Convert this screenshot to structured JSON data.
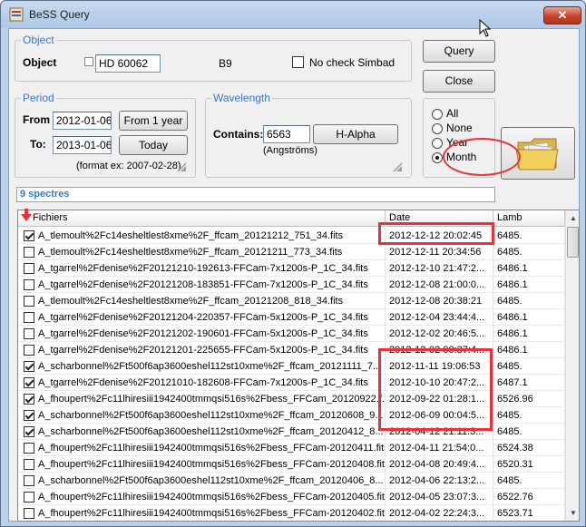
{
  "window": {
    "title": "BeSS Query",
    "close_glyph": "✕"
  },
  "object_group": {
    "title": "Object",
    "object_label": "Object",
    "object_value": "HD 60062",
    "spectral_type": "B9",
    "no_check_label": "No check Simbad"
  },
  "buttons": {
    "query": "Query",
    "close": "Close"
  },
  "period_group": {
    "title": "Period",
    "from_label": "From",
    "from_value": "2012-01-06",
    "from_button": "From 1 year",
    "to_label": "To:",
    "to_value": "2013-01-06",
    "today_button": "Today",
    "format_hint": "(format ex: 2007-02-28)"
  },
  "wavelength_group": {
    "title": "Wavelength",
    "contains_label": "Contains:",
    "contains_value": "6563",
    "unit_hint": "(Angströms)",
    "halpha_button": "H-Alpha"
  },
  "range_options": {
    "items": [
      {
        "label": "All",
        "selected": false
      },
      {
        "label": "None",
        "selected": false
      },
      {
        "label": "Year",
        "selected": false
      },
      {
        "label": "Month",
        "selected": true
      }
    ]
  },
  "status": {
    "text": "9 spectres"
  },
  "table": {
    "columns": [
      "Fichiers",
      "Date",
      "Lamb"
    ],
    "rows": [
      {
        "checked": true,
        "file": "A_tlemoult%2Fc14esheltlest8xme%2F_ffcam_20121212_751_34.fits",
        "date": "2012-12-12 20:02:45",
        "lamb": "6485."
      },
      {
        "checked": false,
        "file": "A_tlemoult%2Fc14esheltlest8xme%2F_ffcam_20121211_773_34.fits",
        "date": "2012-12-11 20:34:56",
        "lamb": "6485."
      },
      {
        "checked": false,
        "file": "A_tgarrel%2Fdenise%2F20121210-192613-FFCam-7x1200s-P_1C_34.fits",
        "date": "2012-12-10 21:47:2...",
        "lamb": "6486.1"
      },
      {
        "checked": false,
        "file": "A_tgarrel%2Fdenise%2F20121208-183851-FFCam-7x1200s-P_1C_34.fits",
        "date": "2012-12-08 21:00:0...",
        "lamb": "6486.1"
      },
      {
        "checked": false,
        "file": "A_tlemoult%2Fc14esheltlest8xme%2F_ffcam_20121208_818_34.fits",
        "date": "2012-12-08 20:38:21",
        "lamb": "6485."
      },
      {
        "checked": false,
        "file": "A_tgarrel%2Fdenise%2F20121204-220357-FFCam-5x1200s-P_1C_34.fits",
        "date": "2012-12-04 23:44:4...",
        "lamb": "6486.1"
      },
      {
        "checked": false,
        "file": "A_tgarrel%2Fdenise%2F20121202-190601-FFCam-5x1200s-P_1C_34.fits",
        "date": "2012-12-02 20:46:5...",
        "lamb": "6486.1"
      },
      {
        "checked": false,
        "file": "A_tgarrel%2Fdenise%2F20121201-225655-FFCam-5x1200s-P_1C_34.fits",
        "date": "2012-12-02 00:37:4...",
        "lamb": "6486.1"
      },
      {
        "checked": true,
        "file": "A_scharbonnel%2Ft500f6ap3600eshel112st10xme%2F_ffcam_20121111_7...",
        "date": "2012-11-11 19:06:53",
        "lamb": "6485."
      },
      {
        "checked": true,
        "file": "A_tgarrel%2Fdenise%2F20121010-182608-FFCam-7x1200s-P_1C_34.fits",
        "date": "2012-10-10 20:47:2...",
        "lamb": "6487.1"
      },
      {
        "checked": true,
        "file": "A_fhoupert%2Fc11lhiresiii1942400tmmqsi516s%2Fbess_FFCam_20120922.f...",
        "date": "2012-09-22 01:28:1...",
        "lamb": "6526.96"
      },
      {
        "checked": true,
        "file": "A_scharbonnel%2Ft500f6ap3600eshel112st10xme%2F_ffcam_20120608_9...",
        "date": "2012-06-09 00:04:5...",
        "lamb": "6485."
      },
      {
        "checked": true,
        "file": "A_scharbonnel%2Ft500f6ap3600eshel112st10xme%2F_ffcam_20120412_8...",
        "date": "2012-04-12 21:11:3...",
        "lamb": "6485."
      },
      {
        "checked": false,
        "file": "A_fhoupert%2Fc11lhiresiii1942400tmmqsi516s%2Fbess_FFCam-20120411.fits",
        "date": "2012-04-11 21:54:0...",
        "lamb": "6524.38"
      },
      {
        "checked": false,
        "file": "A_fhoupert%2Fc11lhiresiii1942400tmmqsi516s%2Fbess_FFCam-20120408.fits",
        "date": "2012-04-08 20:49:4...",
        "lamb": "6520.31"
      },
      {
        "checked": false,
        "file": "A_scharbonnel%2Ft500f6ap3600eshel112st10xme%2F_ffcam_20120406_8...",
        "date": "2012-04-06 22:13:2...",
        "lamb": "6485."
      },
      {
        "checked": false,
        "file": "A_fhoupert%2Fc11lhiresiii1942400tmmqsi516s%2Fbess_FFCam-20120405.fits",
        "date": "2012-04-05 23:07:3...",
        "lamb": "6522.76"
      },
      {
        "checked": false,
        "file": "A_fhoupert%2Fc11lhiresiii1942400tmmqsi516s%2Fbess_FFCam-20120402.fits",
        "date": "2012-04-02 22:24:3...",
        "lamb": "6523.71"
      },
      {
        "checked": false,
        "file": "A_scharbonnel%2Ft500f6ap3600eshel112st10xme%2F_ffcam_20120402_8...",
        "date": "2012-04-02 22:19:5...",
        "lamb": "6485."
      }
    ]
  },
  "colors": {
    "annotation_red": "#e8323c",
    "group_title": "#3a78c9"
  }
}
